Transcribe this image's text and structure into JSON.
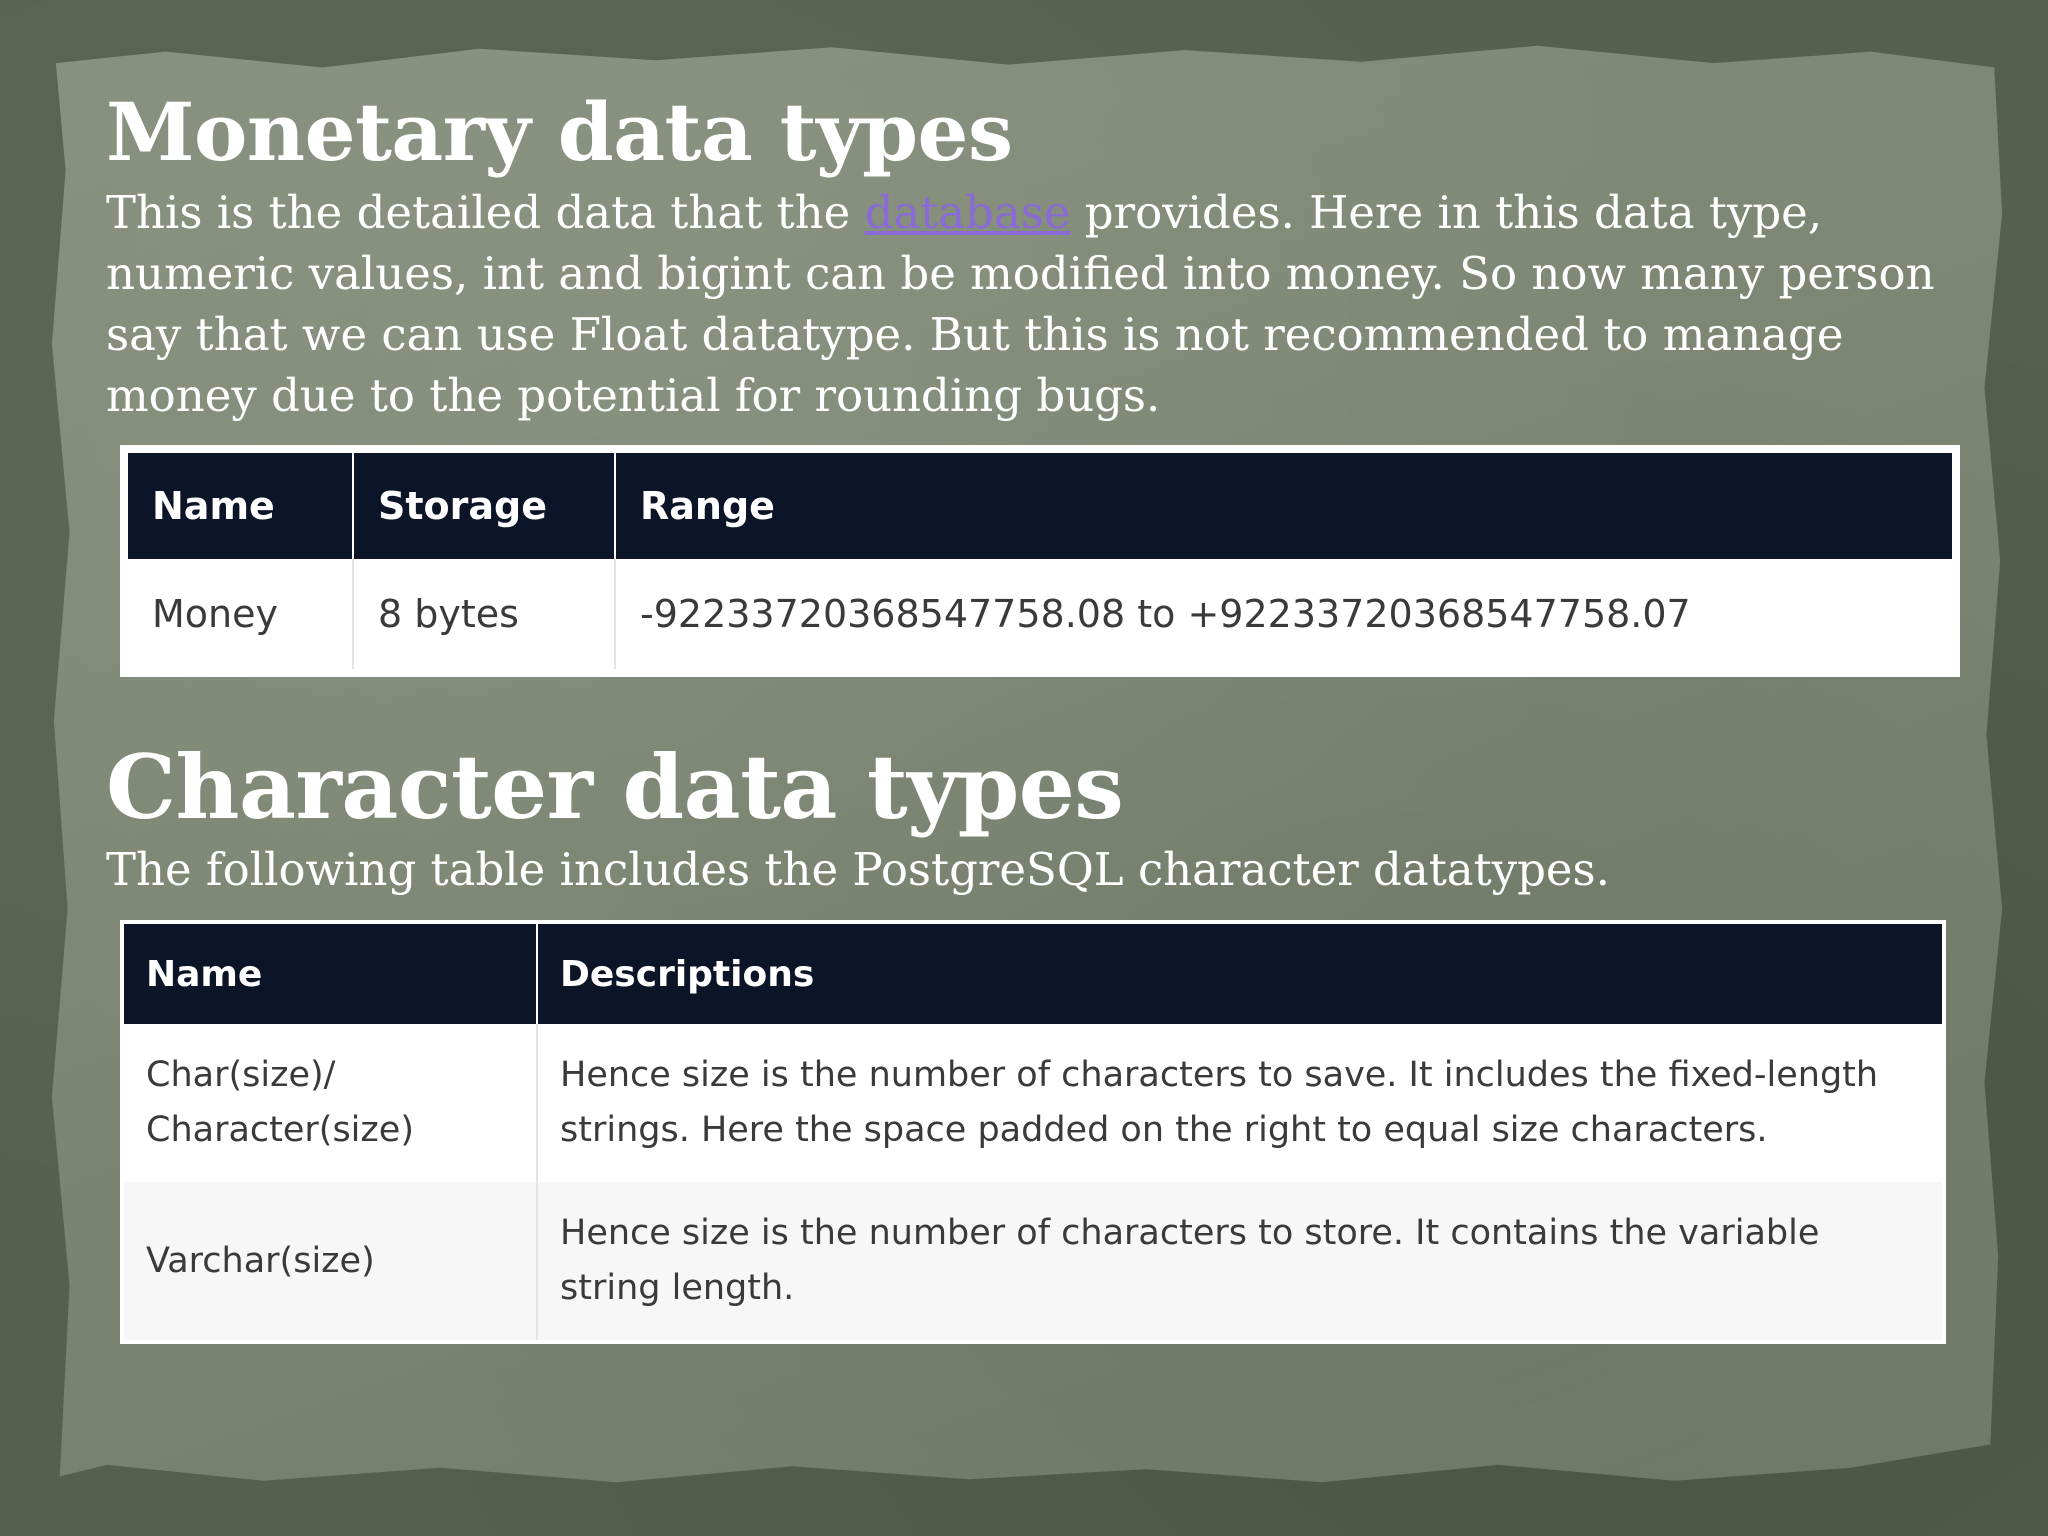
{
  "monetary": {
    "title": "Monetary data types",
    "paragraph": {
      "before_link": "This is the detailed data that the ",
      "link_text": "database",
      "after_link": " provides. Here in this data type, numeric values, int and bigint can be modified into money. So now many person say that we can use Float datatype. But this is not recommended to manage money due to the potential for rounding bugs."
    },
    "table": {
      "headers": [
        "Name",
        "Storage",
        "Range"
      ],
      "rows": [
        [
          "Money",
          "8 bytes",
          "-92233720368547758.08 to +92233720368547758.07"
        ]
      ]
    }
  },
  "character": {
    "title": "Character data types",
    "paragraph": "The following table includes the PostgreSQL character datatypes.",
    "table": {
      "headers": [
        "Name",
        "Descriptions"
      ],
      "rows": [
        {
          "name_line1": "Char(size)/",
          "name_line2": "Character(size)",
          "description": "Hence size is the number of characters to save. It includes the fixed-length strings. Here the space padded on the right to equal size characters."
        },
        {
          "name_line1": "Varchar(size)",
          "name_line2": "",
          "description": "Hence size is the number of characters to store. It contains the variable string length."
        }
      ]
    }
  },
  "colors": {
    "background": "#56604c",
    "paper": "#7f8875",
    "table_header": "#0c1428",
    "link": "#8a6bd6"
  }
}
